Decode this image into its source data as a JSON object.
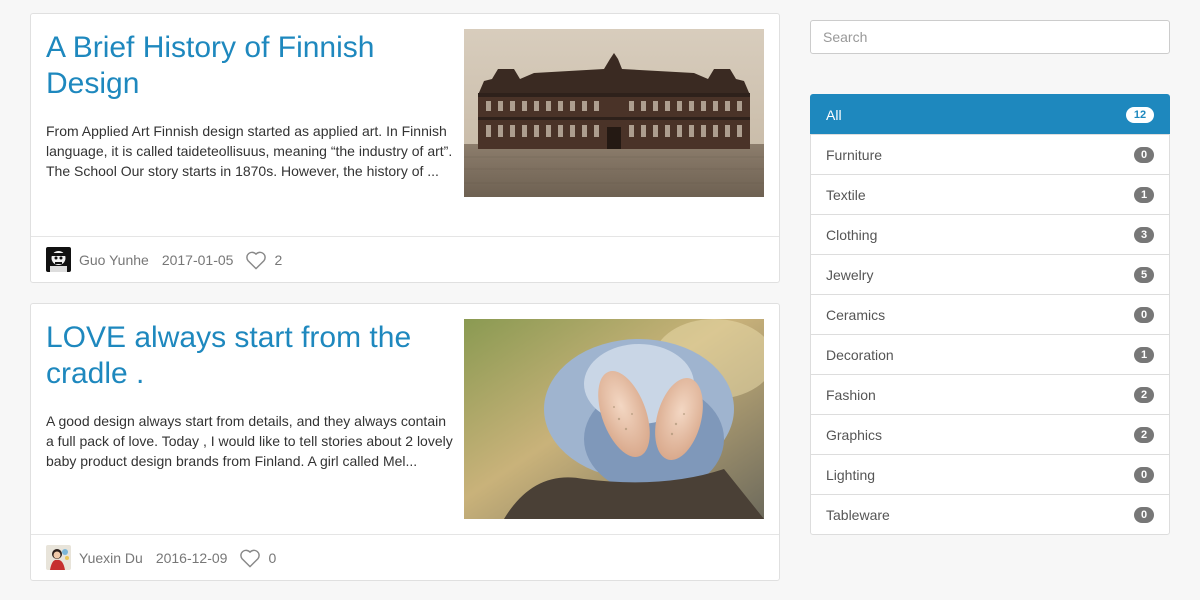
{
  "search": {
    "placeholder": "Search"
  },
  "posts": [
    {
      "title": "A Brief History of Finnish Design",
      "excerpt": "From Applied Art Finnish design started as applied art. In Finnish language, it is called taideteollisuus, meaning “the industry of art”. The School Our story starts in 1870s. However, the history of ...",
      "author": "Guo Yunhe",
      "date": "2017-01-05",
      "likes": "2"
    },
    {
      "title": "LOVE always start from the cradle .",
      "excerpt": "A good design always start from details, and they always contain a full pack of love. Today , I would like to tell stories about 2 lovely baby product design brands from Finland. A girl called Mel...",
      "author": "Yuexin Du",
      "date": "2016-12-09",
      "likes": "0"
    }
  ],
  "categories": [
    {
      "label": "All",
      "count": "12",
      "active": true
    },
    {
      "label": "Furniture",
      "count": "0"
    },
    {
      "label": "Textile",
      "count": "1"
    },
    {
      "label": "Clothing",
      "count": "3"
    },
    {
      "label": "Jewelry",
      "count": "5"
    },
    {
      "label": "Ceramics",
      "count": "0"
    },
    {
      "label": "Decoration",
      "count": "1"
    },
    {
      "label": "Fashion",
      "count": "2"
    },
    {
      "label": "Graphics",
      "count": "2"
    },
    {
      "label": "Lighting",
      "count": "0"
    },
    {
      "label": "Tableware",
      "count": "0"
    }
  ],
  "icons": {
    "like": "heart-outline-icon"
  },
  "colors": {
    "accent": "#1e88be",
    "badge": "#777777",
    "background": "#f7f7f7"
  }
}
